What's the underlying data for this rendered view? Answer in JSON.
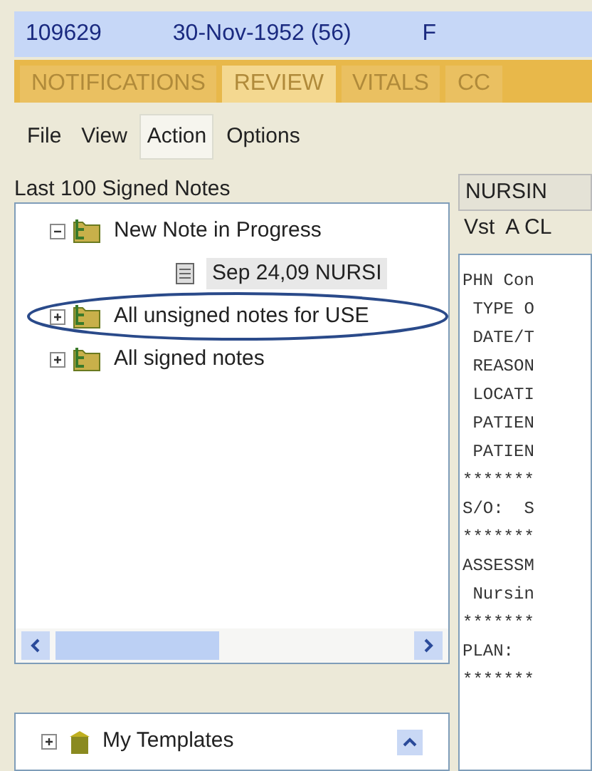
{
  "patient_bar": {
    "id": "109629",
    "dob": "30-Nov-1952 (56)",
    "sex": "F"
  },
  "tabs": [
    {
      "label": "NOTIFICATIONS",
      "selected": false
    },
    {
      "label": "REVIEW",
      "selected": true
    },
    {
      "label": "VITALS",
      "selected": false
    },
    {
      "label": "CC",
      "selected": false
    }
  ],
  "menu": [
    {
      "label": "File",
      "selected": false
    },
    {
      "label": "View",
      "selected": false
    },
    {
      "label": "Action",
      "selected": true
    },
    {
      "label": "Options",
      "selected": false
    }
  ],
  "notes_panel": {
    "title": "Last 100 Signed Notes",
    "tree": [
      {
        "label": "New Note in Progress",
        "expanded": true,
        "selected": false,
        "children": [
          {
            "label": "Sep 24,09  NURSI",
            "kind": "note",
            "selected": true
          }
        ]
      },
      {
        "label": "All unsigned notes for USE",
        "expanded": false,
        "selected": false
      },
      {
        "label": "All signed notes",
        "expanded": false,
        "selected": false
      }
    ]
  },
  "templates": {
    "label": "My Templates",
    "expanded": false
  },
  "note_view": {
    "title": "NURSIN",
    "visit": "Vst  A CL",
    "lines": [
      "PHN Con",
      " TYPE O",
      " DATE/T",
      " REASON",
      " LOCATI",
      " PATIEN",
      " PATIEN",
      "*******",
      "S/O:  S",
      "*******",
      "ASSESSM",
      " Nursin",
      "*******",
      "PLAN:",
      "*******"
    ]
  }
}
